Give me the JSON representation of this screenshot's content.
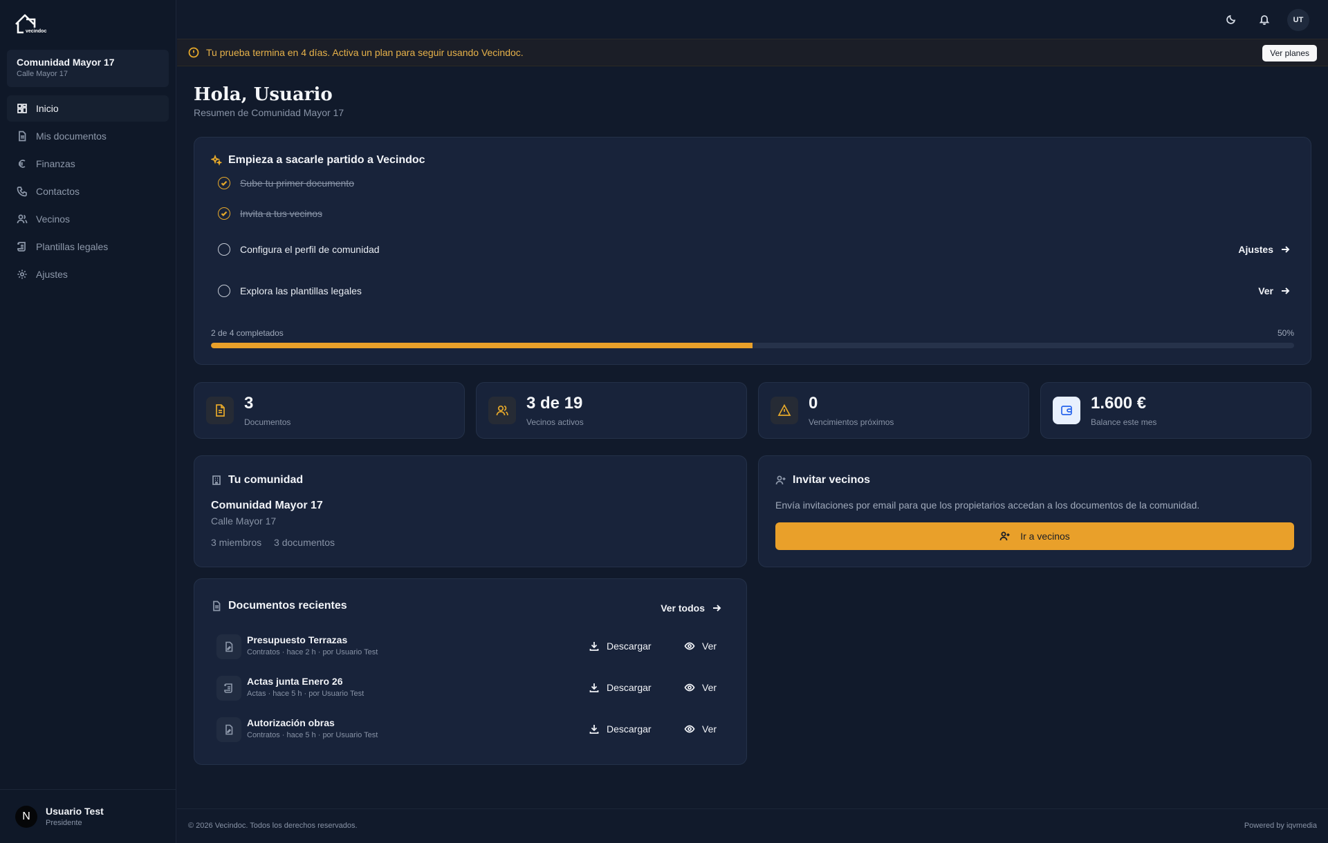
{
  "app": {
    "logo_text": "vecindoc"
  },
  "sidebar": {
    "community_name": "Comunidad Mayor 17",
    "community_address": "Calle Mayor 17",
    "items": [
      {
        "label": "Inicio",
        "icon": "dashboard-icon",
        "active": true
      },
      {
        "label": "Mis documentos",
        "icon": "document-icon"
      },
      {
        "label": "Finanzas",
        "icon": "euro-icon"
      },
      {
        "label": "Contactos",
        "icon": "phone-icon"
      },
      {
        "label": "Vecinos",
        "icon": "users-icon"
      },
      {
        "label": "Plantillas legales",
        "icon": "scroll-icon"
      },
      {
        "label": "Ajustes",
        "icon": "gear-icon"
      }
    ],
    "user": {
      "initial": "N",
      "name": "Usuario Test",
      "role": "Presidente"
    }
  },
  "topbar": {
    "avatar_initials": "UT"
  },
  "banner": {
    "text": "Tu prueba termina en 4 días. Activa un plan para seguir usando Vecindoc.",
    "button": "Ver planes"
  },
  "greeting": {
    "title": "Hola, Usuario",
    "subtitle": "Resumen de Comunidad Mayor 17"
  },
  "onboarding": {
    "title": "Empieza a sacarle partido a Vecindoc",
    "tasks": [
      {
        "label": "Sube tu primer documento",
        "done": true,
        "link": ""
      },
      {
        "label": "Invita a tus vecinos",
        "done": true,
        "link": ""
      },
      {
        "label": "Configura el perfil de comunidad",
        "done": false,
        "link": "Ajustes"
      },
      {
        "label": "Explora las plantillas legales",
        "done": false,
        "link": "Ver"
      }
    ],
    "progress_label": "2 de 4 completados",
    "progress_pct_label": "50%",
    "progress_fraction": 0.5,
    "accent_color": "#e9a02a"
  },
  "stats": [
    {
      "value": "3",
      "label": "Documentos",
      "icon": "document-icon"
    },
    {
      "value": "3 de 19",
      "label": "Vecinos activos",
      "icon": "users-icon"
    },
    {
      "value": "0",
      "label": "Vencimientos próximos",
      "icon": "warning-icon"
    },
    {
      "value": "1.600 €",
      "label": "Balance este mes",
      "icon": "wallet-icon"
    }
  ],
  "community_card": {
    "title": "Tu comunidad",
    "name": "Comunidad Mayor 17",
    "address": "Calle Mayor 17",
    "members": "3 miembros",
    "documents": "3 documentos"
  },
  "invite_card": {
    "title": "Invitar vecinos",
    "description": "Envía invitaciones por email para que los propietarios accedan a los documentos de la comunidad.",
    "button": "Ir a vecinos"
  },
  "recent_docs": {
    "title": "Documentos recientes",
    "see_all": "Ver todos",
    "download_label": "Descargar",
    "view_label": "Ver",
    "rows": [
      {
        "title": "Presupuesto Terrazas",
        "meta": "Contratos · hace 2 h · por Usuario Test"
      },
      {
        "title": "Actas junta Enero 26",
        "meta": "Actas · hace 5 h · por Usuario Test"
      },
      {
        "title": "Autorización obras",
        "meta": "Contratos · hace 5 h · por Usuario Test"
      }
    ]
  },
  "footer": {
    "copyright": "© 2026 Vecindoc. Todos los derechos reservados.",
    "powered": "Powered by iqvmedia"
  }
}
